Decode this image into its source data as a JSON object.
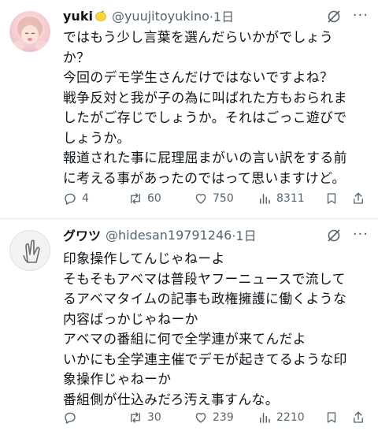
{
  "tweets": [
    {
      "user_name": "yuki",
      "name_emoji": "lemon-emoji",
      "handle": "@yuujitoyukino",
      "time": "·1日",
      "lines": [
        "ではもう少し言葉を選んだらいかがでしょう",
        "か？",
        "今回のデモ学生さんだけではないですよね？",
        "戦争反対と我が子の為に叫ばれた方もおられま",
        "したがご存じでしょうか。それはごっこ遊びで",
        "しょうか。",
        "報道された事に屁理屈まがいの言い訳をする前",
        "に考える事があったのではって思いますけど。"
      ],
      "replies": "4",
      "reposts": "60",
      "likes": "750",
      "views": "8311"
    },
    {
      "user_name": "グワツ",
      "handle": "@hidesan19791246",
      "time": "·1日",
      "lines": [
        "印象操作してんじゃねーよ",
        "そもそもアベマは普段ヤフーニュースで流して",
        "るアベマタイムの記事も政権擁護に働くような",
        "内容ばっかじゃねーか",
        "アベマの番組に何で全学連が来てんだよ",
        "いかにも全学連主催でデモが起きてるような印",
        "象操作じゃねーか",
        "番組側が仕込みだろ汚え事すんな。"
      ],
      "replies": "",
      "reposts": "30",
      "likes": "239",
      "views": "2210"
    }
  ],
  "colors": {
    "text": "#0f1419",
    "muted": "#536471",
    "divider": "#e6ecf0"
  }
}
